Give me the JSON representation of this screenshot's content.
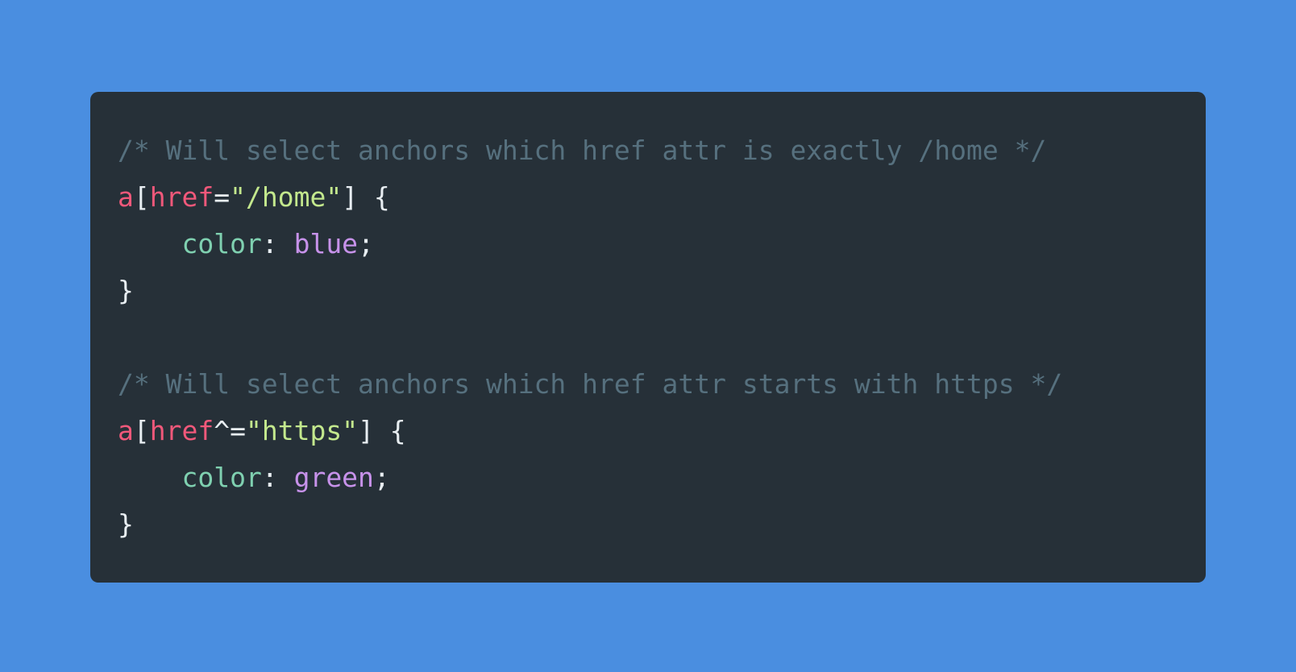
{
  "colors": {
    "background": "#4a8ee0",
    "editor_background": "#263038",
    "comment": "#56707e",
    "selector": "#f0587a",
    "string": "#c3e88d",
    "property": "#7fd0b0",
    "value": "#c792ea",
    "punctuation": "#e8eef2"
  },
  "code": {
    "block1": {
      "comment": "/* Will select anchors which href attr is exactly /home */",
      "selector_tag": "a",
      "open_bracket": "[",
      "attr_name": "href",
      "operator": "=",
      "attr_value": "\"/home\"",
      "close_bracket_brace": "] {",
      "indent": "    ",
      "property": "color",
      "colon": ": ",
      "value": "blue",
      "semicolon": ";",
      "close_brace": "}"
    },
    "block2": {
      "comment": "/* Will select anchors which href attr starts with https */",
      "selector_tag": "a",
      "open_bracket": "[",
      "attr_name": "href",
      "operator": "^=",
      "attr_value": "\"https\"",
      "close_bracket_brace": "] {",
      "indent": "    ",
      "property": "color",
      "colon": ": ",
      "value": "green",
      "semicolon": ";",
      "close_brace": "}"
    }
  }
}
